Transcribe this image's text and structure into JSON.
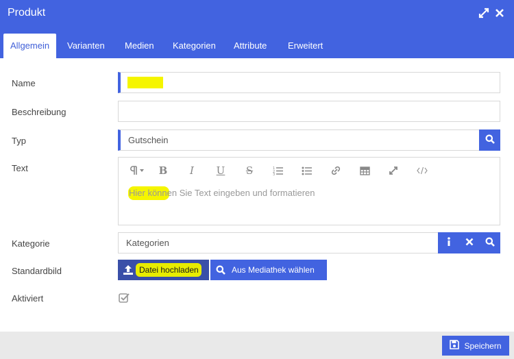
{
  "window": {
    "title": "Produkt"
  },
  "tabs": [
    {
      "label": "Allgemein"
    },
    {
      "label": "Varianten"
    },
    {
      "label": "Medien"
    },
    {
      "label": "Kategorien"
    },
    {
      "label": "Attribute"
    },
    {
      "label": "Erweitert"
    }
  ],
  "form": {
    "name_label": "Name",
    "name_value": "",
    "beschreibung_label": "Beschreibung",
    "beschreibung_value": "",
    "typ_label": "Typ",
    "typ_value": "Gutschein",
    "text_label": "Text",
    "text_placeholder": "Hier können Sie Text eingeben und formatieren",
    "kategorie_label": "Kategorie",
    "kategorie_value": "Kategorien",
    "standardbild_label": "Standardbild",
    "upload_label": "Datei hochladen",
    "mediathek_label": "Aus Mediathek wählen",
    "aktiviert_label": "Aktiviert",
    "aktiviert_checked": true
  },
  "editor_toolbar": [
    {
      "icon": "paragraph-icon"
    },
    {
      "icon": "bold-icon"
    },
    {
      "icon": "italic-icon"
    },
    {
      "icon": "underline-icon"
    },
    {
      "icon": "strikethrough-icon"
    },
    {
      "icon": "ordered-list-icon"
    },
    {
      "icon": "unordered-list-icon"
    },
    {
      "icon": "link-icon"
    },
    {
      "icon": "table-icon"
    },
    {
      "icon": "fullscreen-icon"
    },
    {
      "icon": "code-view-icon"
    }
  ],
  "footer": {
    "save_label": "Speichern"
  },
  "colors": {
    "accent": "#4263e0",
    "highlight": "#f5f500",
    "footer_bg": "#e9e9e9"
  }
}
